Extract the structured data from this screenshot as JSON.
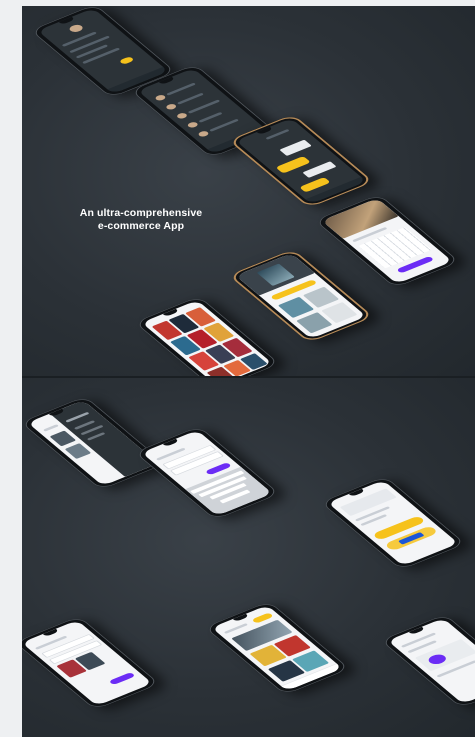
{
  "hero": {
    "line1": "An ultra-comprehensive",
    "line2": "e-commerce App"
  },
  "colors": {
    "background": "#2b3137",
    "accent_yellow": "#f6c21c",
    "accent_purple": "#6b2cf5",
    "phone_gold": "#b58a58"
  },
  "phones": [
    {
      "screen": "profile-menu",
      "theme": "dark"
    },
    {
      "screen": "reviews-list",
      "theme": "dark"
    },
    {
      "screen": "chat",
      "theme": "dark"
    },
    {
      "screen": "calendar-booking",
      "theme": "light"
    },
    {
      "screen": "book-detail",
      "theme": "light"
    },
    {
      "screen": "catalog-grid",
      "theme": "light"
    },
    {
      "screen": "navigation-menu",
      "theme": "dark"
    },
    {
      "screen": "sign-up-keyboard",
      "theme": "light"
    },
    {
      "screen": "checkout",
      "theme": "light"
    },
    {
      "screen": "filter-list",
      "theme": "light"
    },
    {
      "screen": "home-feed",
      "theme": "light"
    },
    {
      "screen": "order-tracking",
      "theme": "light"
    }
  ]
}
